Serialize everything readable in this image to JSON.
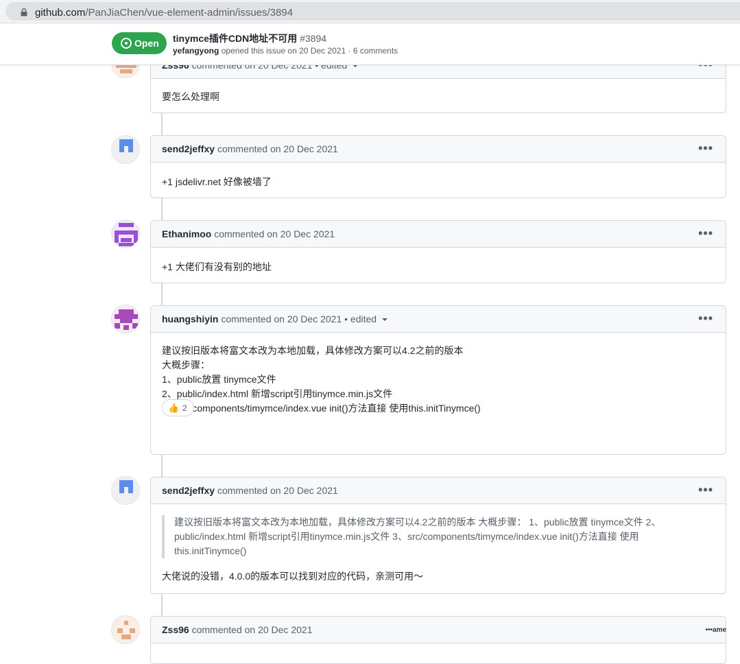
{
  "browser": {
    "url_host": "github.com",
    "url_path": "/PanJiaChen/vue-element-admin/issues/3894"
  },
  "issue": {
    "state": "Open",
    "title": "tinymce插件CDN地址不可用",
    "number": "#3894",
    "author": "yefangyong",
    "meta": "opened this issue on 20 Dec 2021 · 6 comments"
  },
  "comments": [
    {
      "author": "Zss96",
      "meta": "commented on 20 Dec 2021 • edited",
      "body": "要怎么处理啊"
    },
    {
      "author": "send2jeffxy",
      "meta": "commented on 20 Dec 2021",
      "body": "+1 jsdelivr.net 好像被墙了"
    },
    {
      "author": "Ethanimoo",
      "meta": "commented on 20 Dec 2021",
      "body": "+1 大佬们有没有别的地址"
    },
    {
      "author": "huangshiyin",
      "meta": "commented on 20 Dec 2021 • edited",
      "lines": [
        "建议按旧版本将富文本改为本地加载，具体修改方案可以4.2之前的版本",
        "大概步骤：",
        "1、public放置 tinymce文件",
        "2、public/index.html 新增script引用tinymce.min.js文件",
        "3、src/components/timymce/index.vue init()方法直接 使用this.initTinymce()"
      ],
      "reaction_count": "2"
    },
    {
      "author": "send2jeffxy",
      "meta": "commented on 20 Dec 2021",
      "quote": [
        "建议按旧版本将富文本改为本地加载，具体修改方案可以4.2之前的版本 大概步骤： 1、public放置 tinymce文件 2、",
        "public/index.html 新增script引用tinymce.min.js文件 3、src/components/timymce/index.vue init()方法直接 使用",
        "this.initTinymce()"
      ],
      "body": "大佬说的没错，4.0.0的版本可以找到对应的代码，亲测可用～"
    },
    {
      "author": "Zss96",
      "meta": "commented on 20 Dec 2021"
    }
  ],
  "more_menu": "•••",
  "watermark": "ame"
}
